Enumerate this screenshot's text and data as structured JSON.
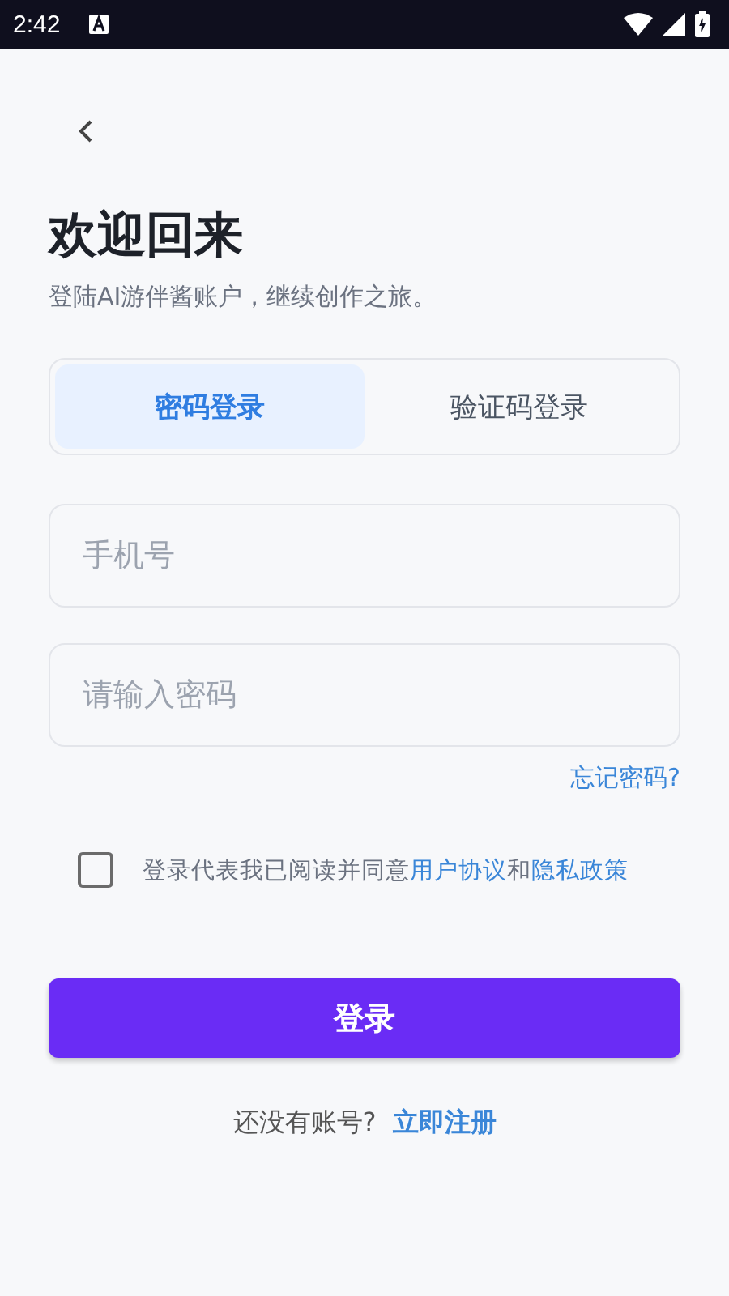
{
  "status_bar": {
    "time": "2:42"
  },
  "title": "欢迎回来",
  "subtitle": "登陆AI游伴酱账户，继续创作之旅。",
  "tabs": [
    {
      "label": "密码登录",
      "selected": true
    },
    {
      "label": "验证码登录",
      "selected": false
    }
  ],
  "fields": [
    {
      "placeholder": "手机号"
    },
    {
      "placeholder": "请输入密码"
    }
  ],
  "forgot_link": "忘记密码?",
  "agreement": {
    "checked": false,
    "parts": [
      {
        "kind": "text",
        "text": "登录代表我已阅读并同意"
      },
      {
        "kind": "link",
        "text": "用户协议"
      },
      {
        "kind": "text",
        "text": "和"
      },
      {
        "kind": "link",
        "text": "隐私政策"
      }
    ]
  },
  "login_button": "登录",
  "register": {
    "prompt": "还没有账号?",
    "link": "立即注册"
  }
}
